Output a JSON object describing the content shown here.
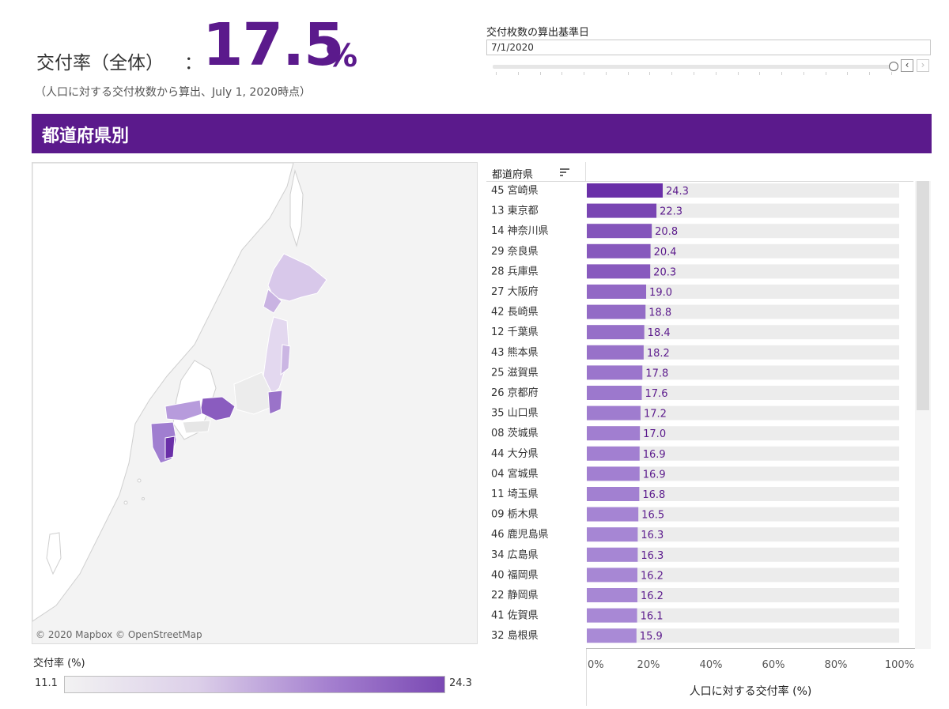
{
  "header": {
    "kpi_label": "交付率（全体）",
    "kpi_colon": "：",
    "kpi_value": "17.5",
    "kpi_unit": "%",
    "kpi_subtitle": "（人口に対する交付枚数から算出、July 1, 2020時点）"
  },
  "date_filter": {
    "label": "交付枚数の算出基準日",
    "value": "7/1/2020",
    "slider_position": 1.0,
    "prev_icon": "chevron-left-icon",
    "next_icon": "chevron-right-icon"
  },
  "section": {
    "title": "都道府県別"
  },
  "map": {
    "attribution": "© 2020 Mapbox © OpenStreetMap",
    "legend_title": "交付率 (%)",
    "legend_min": "11.1",
    "legend_max": "24.3",
    "colors": {
      "low": "#f2f2f2",
      "high": "#7a49b3"
    }
  },
  "chart_header": "都道府県",
  "chart_data": {
    "type": "bar",
    "orientation": "horizontal",
    "categories": [
      "45 宮崎県",
      "13 東京都",
      "14 神奈川県",
      "29 奈良県",
      "28 兵庫県",
      "27 大阪府",
      "42 長崎県",
      "12 千葉県",
      "43 熊本県",
      "25 滋賀県",
      "26 京都府",
      "35 山口県",
      "08 茨城県",
      "44 大分県",
      "04 宮城県",
      "11 埼玉県",
      "09 栃木県",
      "46 鹿児島県",
      "34 広島県",
      "40 福岡県",
      "22 静岡県",
      "41 佐賀県",
      "32 島根県"
    ],
    "values": [
      24.3,
      22.3,
      20.8,
      20.4,
      20.3,
      19.0,
      18.8,
      18.4,
      18.2,
      17.8,
      17.6,
      17.2,
      17.0,
      16.9,
      16.9,
      16.8,
      16.5,
      16.3,
      16.3,
      16.2,
      16.2,
      16.1,
      15.9
    ],
    "xlim": [
      0,
      100
    ],
    "xticks": [
      "0%",
      "20%",
      "40%",
      "60%",
      "80%",
      "100%"
    ],
    "xlabel": "人口に対する交付率 (%)",
    "color_min": "#a98ad6",
    "color_max": "#6a2fa8",
    "background_bar_color": "#ececec",
    "label_color": "#5b1a8c"
  }
}
